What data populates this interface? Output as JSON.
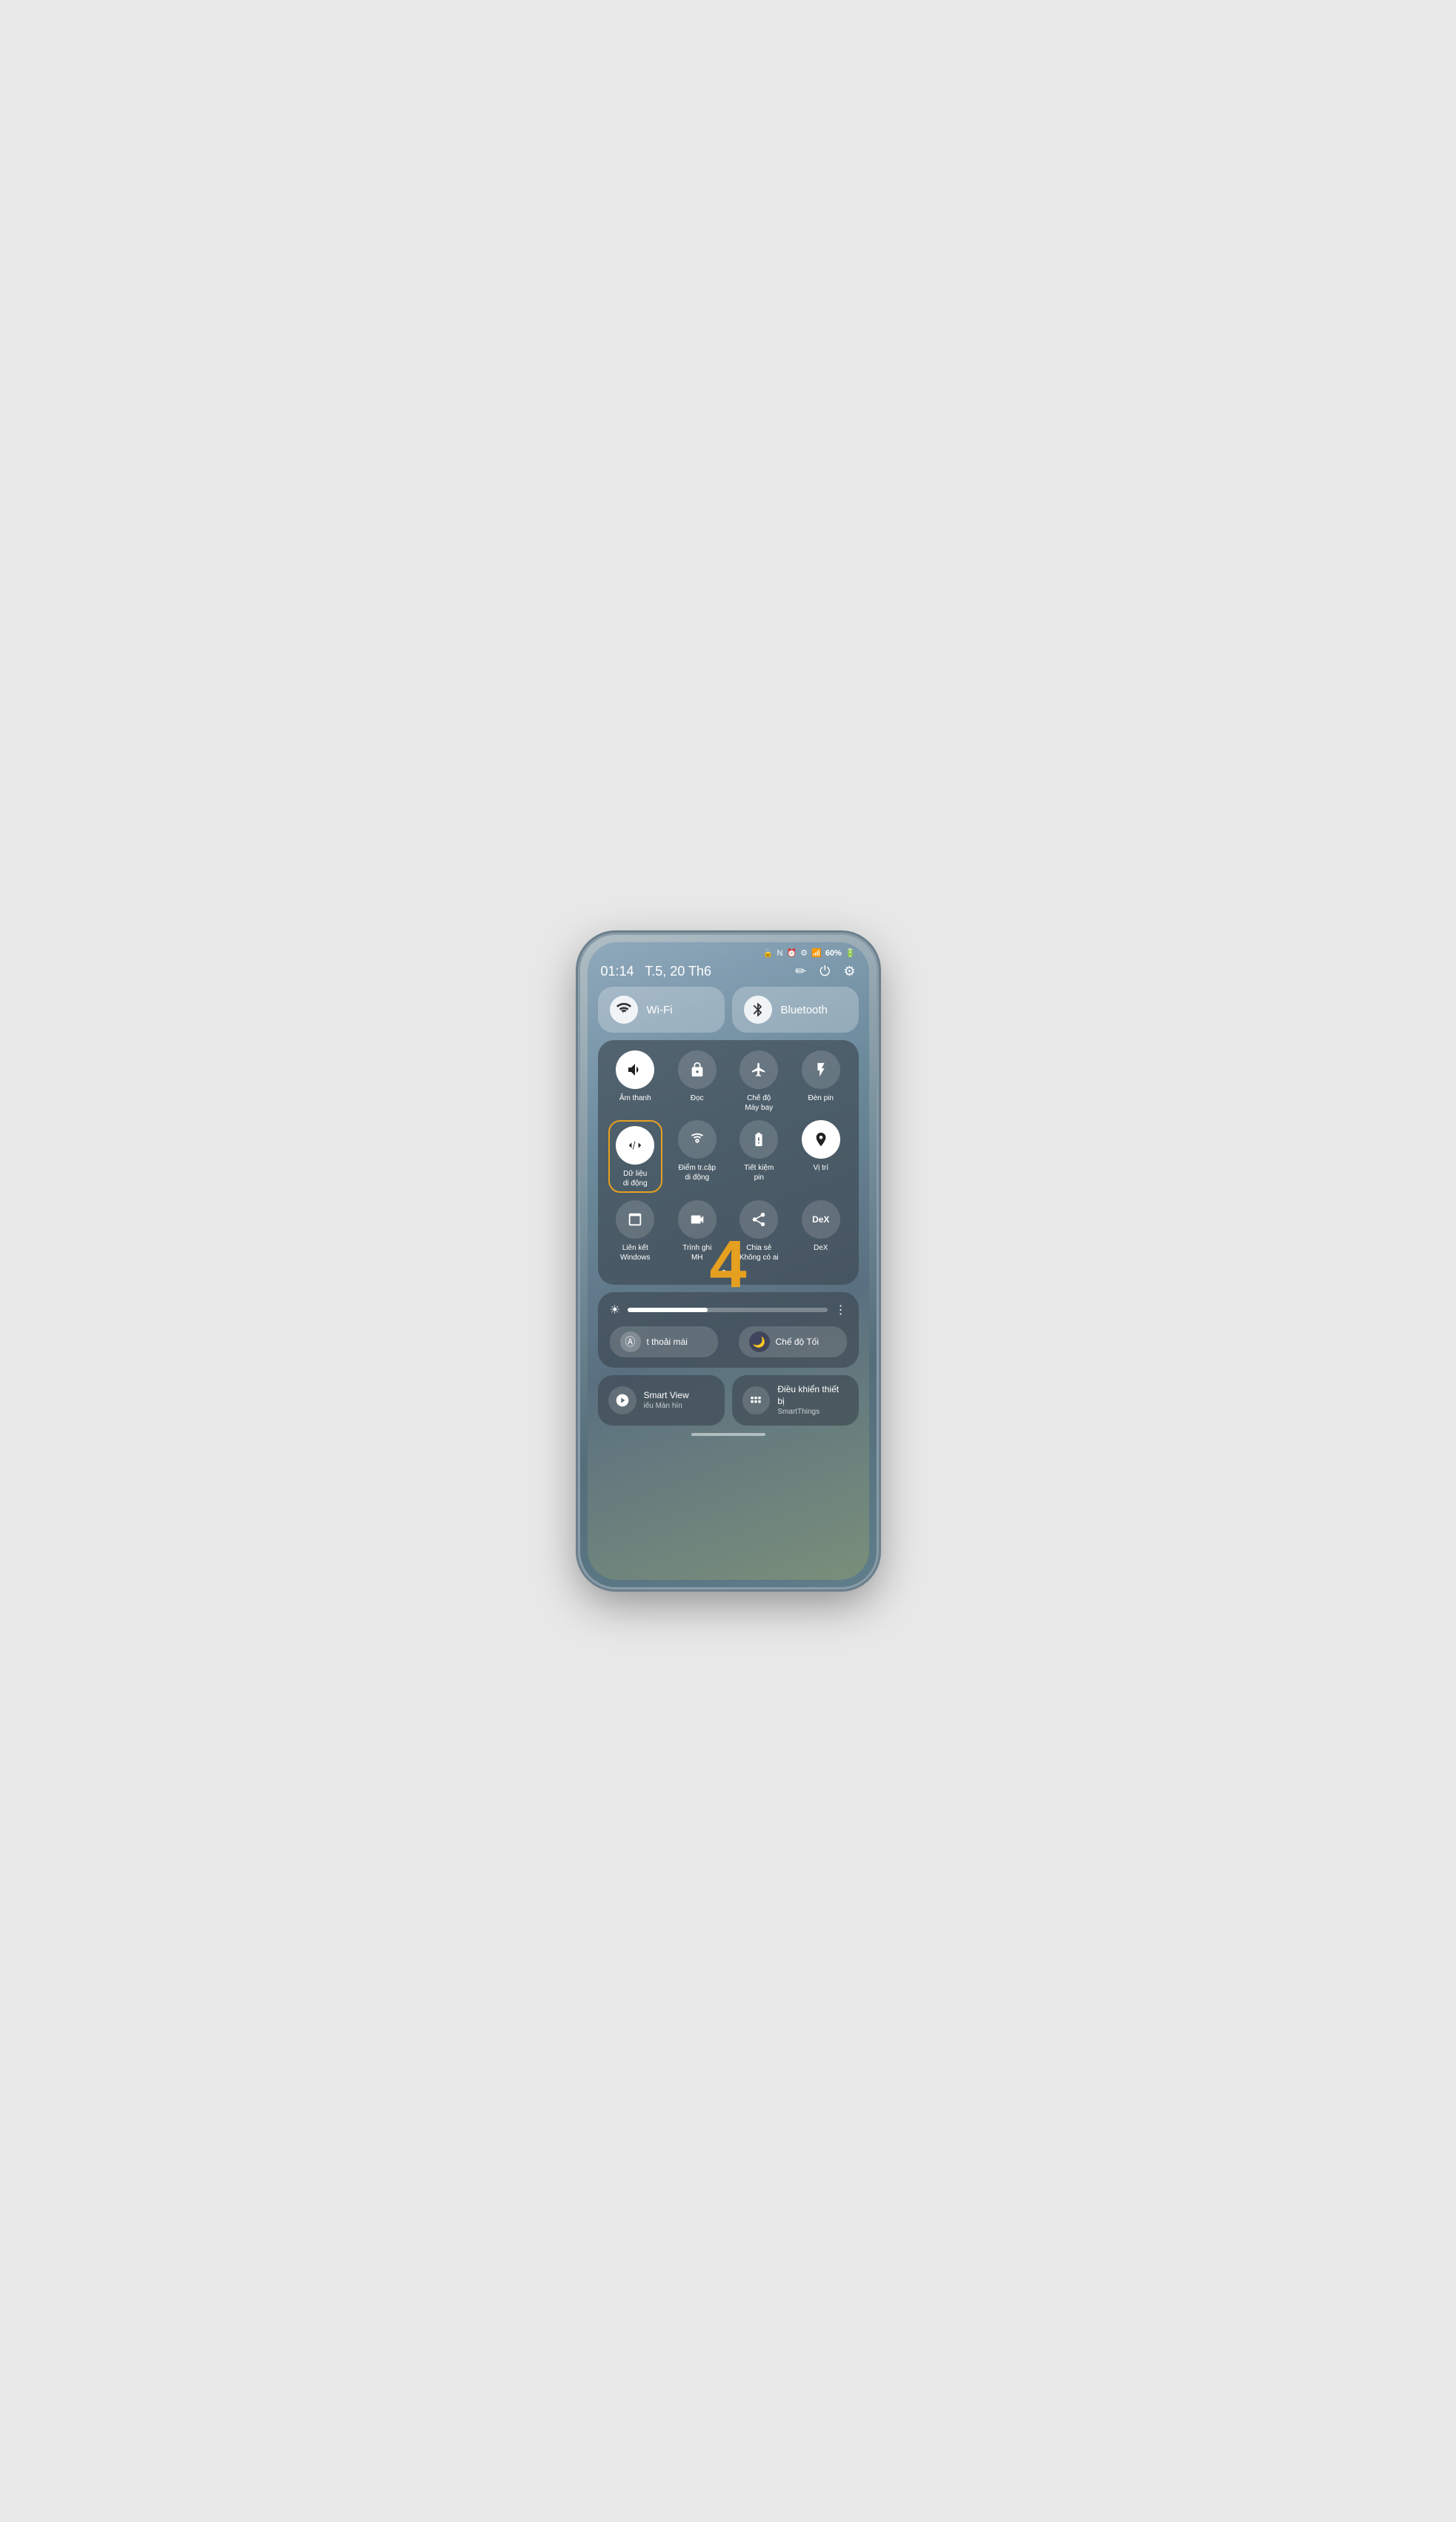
{
  "status_bar": {
    "icons": [
      "🔒",
      "N",
      "⏰",
      "⚙",
      "📶"
    ],
    "battery": "60%"
  },
  "header": {
    "time": "01:14",
    "date": "T.5, 20 Th6",
    "edit_icon": "✏",
    "power_icon": "⏻",
    "settings_icon": "⚙"
  },
  "top_toggles": [
    {
      "id": "wifi",
      "icon": "📶",
      "label": "Wi-Fi"
    },
    {
      "id": "bluetooth",
      "icon": "✱",
      "label": "Bluetooth"
    }
  ],
  "tiles": [
    {
      "id": "sound",
      "icon": "🔊",
      "label": "Âm thanh",
      "active": true
    },
    {
      "id": "doc",
      "icon": "🔒",
      "label": "Đọc",
      "active": false
    },
    {
      "id": "airplane",
      "icon": "✈",
      "label": "Chế độ\nMáy bay",
      "active": false
    },
    {
      "id": "torch",
      "icon": "🔦",
      "label": "Đèn pin",
      "active": false
    },
    {
      "id": "data",
      "icon": "⇅",
      "label": "Dữ liệu\ndi động",
      "active": true,
      "highlighted": true
    },
    {
      "id": "hotspot",
      "icon": "📡",
      "label": "Điểm tr.cập\ndi động",
      "active": false
    },
    {
      "id": "battery_save",
      "icon": "🔋",
      "label": "Tiết kiệm\npin",
      "active": false
    },
    {
      "id": "location",
      "icon": "📍",
      "label": "Vị trí",
      "active": false
    },
    {
      "id": "link_windows",
      "icon": "🖥",
      "label": "Liên kết\nWindows",
      "active": false
    },
    {
      "id": "screen_record",
      "icon": "⏺",
      "label": "Trình ghi\nMH",
      "active": false
    },
    {
      "id": "share",
      "icon": "⇄",
      "label": "Chia sẻ\nKhông có ai",
      "active": false
    },
    {
      "id": "dex",
      "icon": "DeX",
      "label": "DeX",
      "active": false
    }
  ],
  "dots": [
    {
      "active": true
    },
    {
      "active": false
    }
  ],
  "number_overlay": "4",
  "brightness": {
    "fill_percent": 40
  },
  "extra_toggles": [
    {
      "id": "adaptive",
      "icon": "A",
      "label": "t thoải mái"
    },
    {
      "id": "dark_mode",
      "icon": "🌙",
      "label": "Chế độ Tối"
    }
  ],
  "bottom_buttons": [
    {
      "id": "smart_view",
      "icon": "▶",
      "label": "Smart View",
      "sublabel": "iếu    Màn hìn"
    },
    {
      "id": "smart_things",
      "icon": "⠿",
      "label": "Điều khiển thiết bị",
      "sublabel": "SmartThings"
    }
  ]
}
